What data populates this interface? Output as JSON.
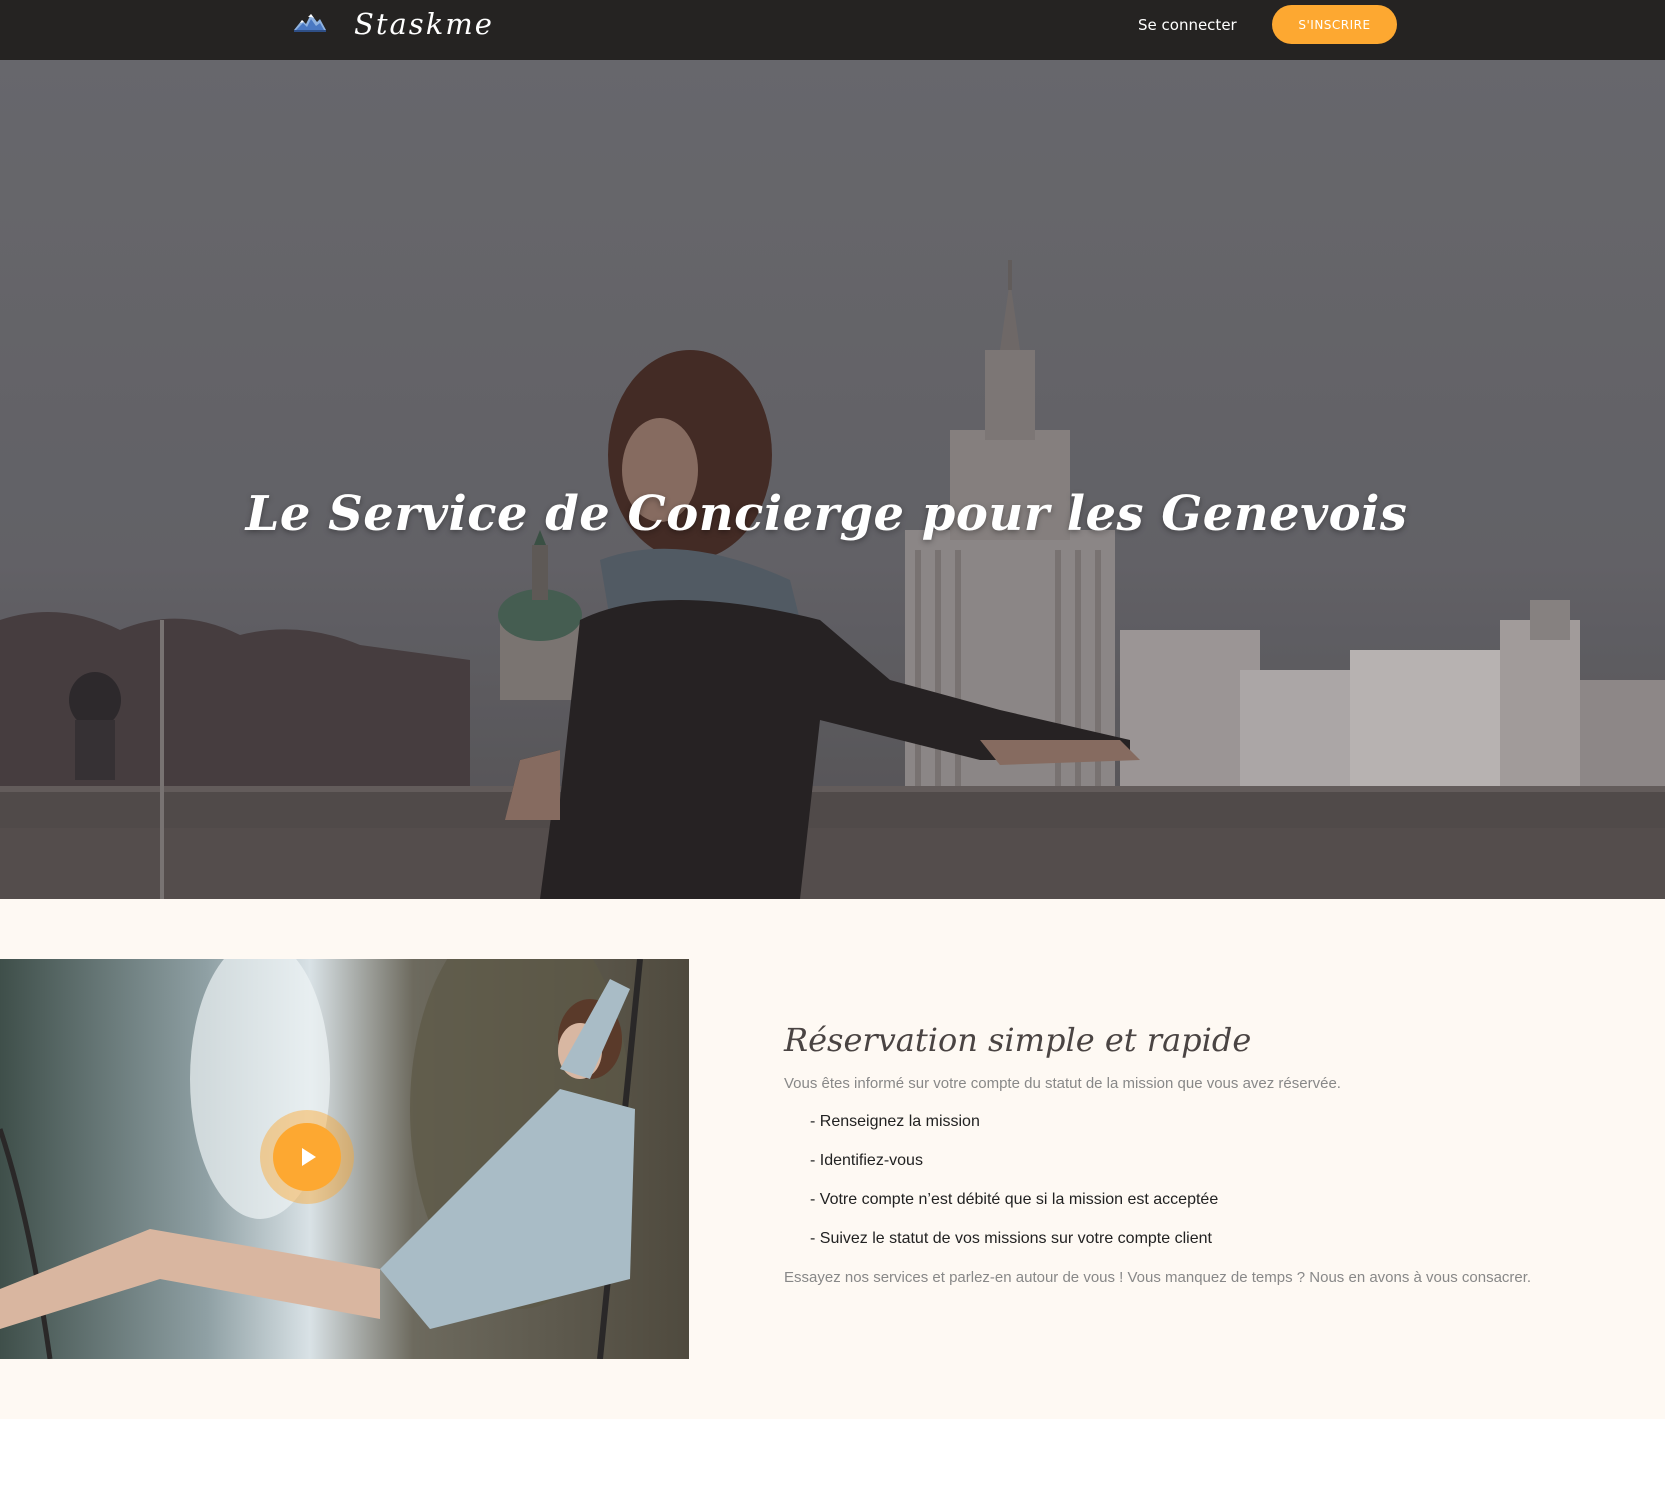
{
  "nav": {
    "brand": "Staskme",
    "login_label": "Se connecter",
    "signup_label": "S'INSCRIRE"
  },
  "hero": {
    "title": "Le Service de Concierge pour les Genevois"
  },
  "reservation": {
    "title": "Réservation simple et rapide",
    "intro": "Vous êtes informé sur votre compte du statut de la mission que vous avez réservée.",
    "steps": [
      "- Renseignez la mission",
      "- Identifiez-vous",
      "- Votre compte n’est débité que si la mission est acceptée",
      "- Suivez le statut de vos missions sur votre compte client"
    ],
    "outro": "Essayez nos services et parlez-en autour de vous ! Vous manquez de temps ? Nous en avons à vous consacrer."
  },
  "colors": {
    "nav_bg": "#252322",
    "accent": "#fda831",
    "section_bg": "#fef9f3",
    "title_text": "#4a4443",
    "muted_text": "#888888"
  },
  "icons": {
    "logo": "mountain-logo-icon",
    "play": "play-icon"
  }
}
